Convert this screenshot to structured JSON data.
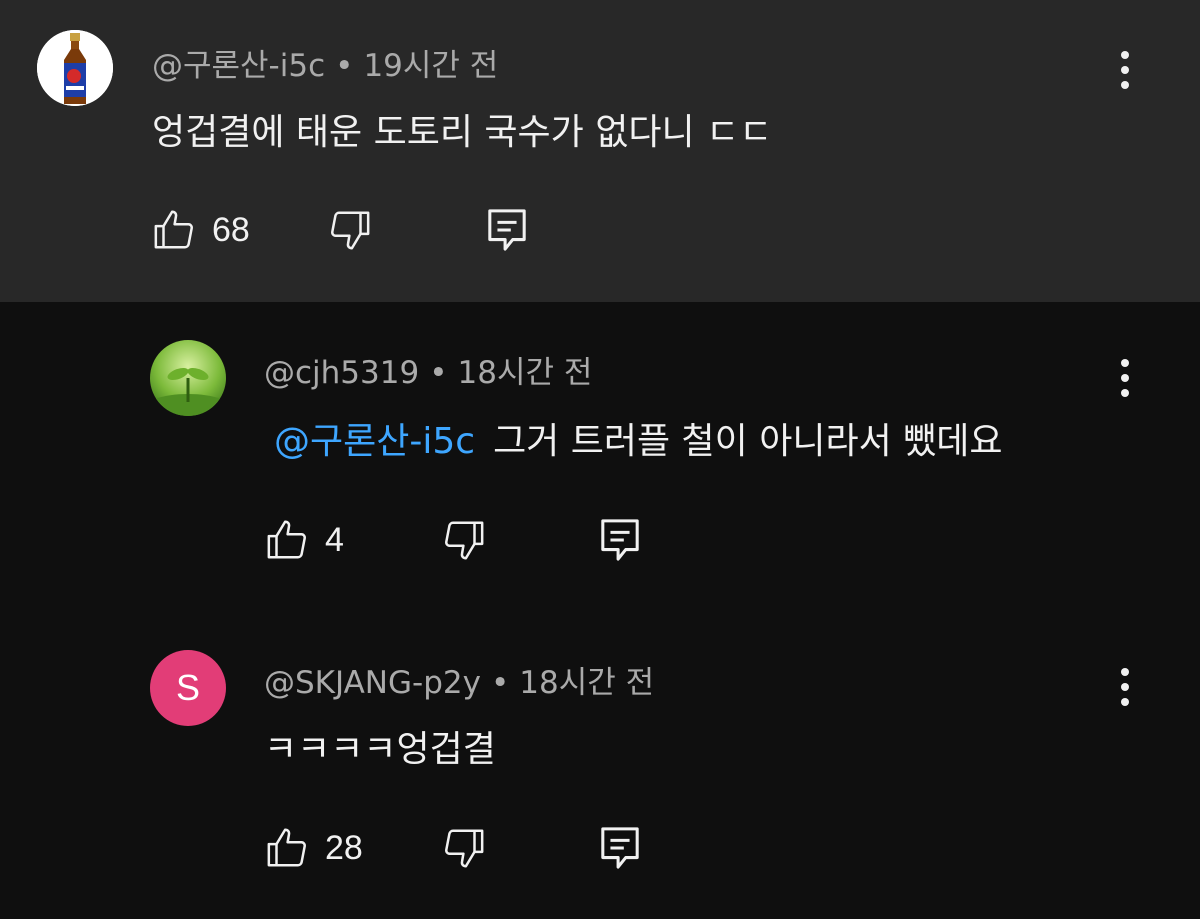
{
  "comments": [
    {
      "author": "@구론산-i5c",
      "separator": "•",
      "time": "19시간 전",
      "mention": "",
      "text": "엉겁결에 태운 도토리 국수가 없다니 ㄷㄷ",
      "likes": "68",
      "avatar_icon": "tonic-bottle-avatar"
    },
    {
      "author": "@cjh5319",
      "separator": "•",
      "time": "18시간 전",
      "mention": "@구론산-i5c",
      "text": "그거 트러플 철이 아니라서 뺐데요",
      "likes": "4",
      "avatar_icon": "sprout-avatar"
    },
    {
      "author": "@SKJANG-p2y",
      "separator": "•",
      "time": "18시간 전",
      "mention": "",
      "text": "ㅋㅋㅋㅋ엉겁결",
      "likes": "28",
      "avatar_letter": "S",
      "avatar_color": "#e23d77"
    }
  ],
  "colors": {
    "top_background": "#282828",
    "page_background": "#0f0f0f",
    "mention": "#3ea6ff",
    "meta_text": "#aaaaaa"
  },
  "icons": [
    "thumbs-up-icon",
    "thumbs-down-icon",
    "reply-icon",
    "more-options-icon"
  ]
}
